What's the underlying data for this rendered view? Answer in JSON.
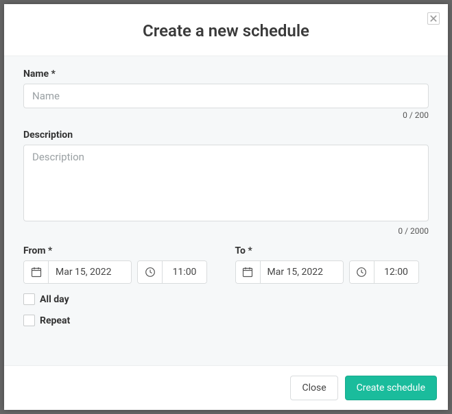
{
  "header": {
    "title": "Create a new schedule"
  },
  "fields": {
    "name": {
      "label": "Name *",
      "placeholder": "Name",
      "value": "",
      "counter": "0 / 200"
    },
    "description": {
      "label": "Description",
      "placeholder": "Description",
      "value": "",
      "counter": "0 / 2000"
    },
    "from": {
      "label": "From *",
      "date": "Mar 15, 2022",
      "time": "11:00"
    },
    "to": {
      "label": "To *",
      "date": "Mar 15, 2022",
      "time": "12:00"
    },
    "allday": {
      "label": "All day",
      "checked": false
    },
    "repeat": {
      "label": "Repeat",
      "checked": false
    }
  },
  "footer": {
    "close": "Close",
    "create": "Create schedule"
  }
}
